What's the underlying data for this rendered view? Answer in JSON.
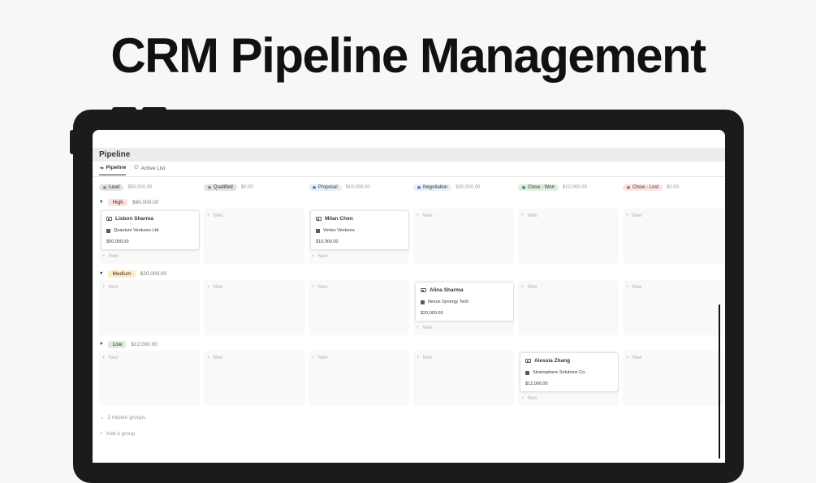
{
  "hero_title": "CRM Pipeline Management",
  "page": {
    "title": "Pipeline",
    "tabs": [
      {
        "label": "Pipeline",
        "icon": "arrow-into-box-icon",
        "active": true
      },
      {
        "label": "Active List",
        "icon": "power-icon",
        "active": false
      }
    ]
  },
  "columns": [
    {
      "label": "Lead",
      "amount": "$50,000.00",
      "pill_bg": "#e3e2e0",
      "dot": "#91918e"
    },
    {
      "label": "Qualified",
      "amount": "$0.00",
      "pill_bg": "#e3e2e0",
      "dot": "#91918e"
    },
    {
      "label": "Proposal",
      "amount": "$10,000.00",
      "pill_bg": "#e7f0f8",
      "dot": "#5e87c9"
    },
    {
      "label": "Negotiation",
      "amount": "$20,000.00",
      "pill_bg": "#e7f0f8",
      "dot": "#5e87c9"
    },
    {
      "label": "Close - Won",
      "amount": "$12,000.00",
      "pill_bg": "#dcefe2",
      "dot": "#4b9a68"
    },
    {
      "label": "Close - Lost",
      "amount": "$0.00",
      "pill_bg": "#fbe4e4",
      "dot": "#d86262"
    }
  ],
  "groups": [
    {
      "label": "High",
      "amount": "$60,000.00",
      "bg": "#fbe4e4",
      "fg": "#5d1715"
    },
    {
      "label": "Medium",
      "amount": "$20,000.00",
      "bg": "#fdecc8",
      "fg": "#402c1b"
    },
    {
      "label": "Low",
      "amount": "$12,000.00",
      "bg": "#dbeddb",
      "fg": "#1c3829"
    }
  ],
  "new_label": "New",
  "cards": [
    {
      "name": "Lisbon Sharma",
      "company": "Quantum Ventures Ltd.",
      "amount": "$50,000.00"
    },
    {
      "name": "Milan Chen",
      "company": "Vertex Ventures",
      "amount": "$10,000.00"
    },
    {
      "name": "Alina Sharma",
      "company": "Nexus Synergy Tech",
      "amount": "$20,000.00"
    },
    {
      "name": "Alessia Zhang",
      "company": "Stratosphere Solutions Co.",
      "amount": "$12,000.00"
    }
  ],
  "footer": {
    "hidden_groups": "2 hidden groups",
    "add_group": "Add a group"
  }
}
